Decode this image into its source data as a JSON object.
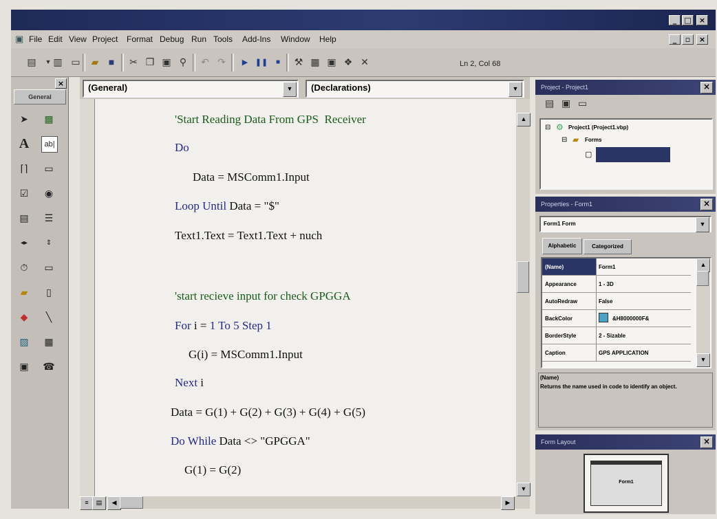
{
  "window": {
    "min_btn": "_",
    "max_btn": "□",
    "close_btn": "×",
    "doc_min_btn": "_",
    "doc_max_btn": "▫",
    "doc_close_btn": "×"
  },
  "menu": [
    "File",
    "Edit",
    "View",
    "Project",
    "Format",
    "Debug",
    "Run",
    "Tools",
    "Add-Ins",
    "Window",
    "Help"
  ],
  "toolbar": {
    "position": "Ln 2, Col 68"
  },
  "toolbox": {
    "title": "General",
    "close": "×"
  },
  "editor": {
    "object_combo": "(General)",
    "proc_combo": "(Declarations)",
    "lines": [
      {
        "text": "'Start Reading Data From GPS  Receiver"
      },
      {
        "kw": "Do"
      },
      {
        "text": "Data = MSComm1.Input"
      },
      {
        "kw": "Loop Until",
        "text": " Data = \"$\""
      },
      {
        "text": "Text1.Text = Text1.Text + nuch"
      },
      {
        "text": "'start recieve input for check GPGGA"
      },
      {
        "kw": "For",
        "text": " i = ",
        "kw2": "1 To 5 Step 1"
      },
      {
        "text": "G(i) = MSComm1.Input"
      },
      {
        "kw": "Next",
        "text": " i"
      },
      {
        "text": "Data = G(1) + G(2) + G(3) + G(4) + G(5)"
      },
      {
        "kw": "Do While",
        "text": " Data <> \"GPGGA\""
      },
      {
        "text": "G(1) = G(2)"
      }
    ]
  },
  "project": {
    "title": "Project - Project1",
    "root": "Project1 (Project1.vbp)",
    "folder": "Forms",
    "close": "×"
  },
  "properties": {
    "title": "Properties - Form1",
    "object_combo": "Form1 Form",
    "tab_alpha": "Alphabetic",
    "tab_cat": "Categorized",
    "rows": [
      {
        "name": "(Name)",
        "value": "Form1"
      },
      {
        "name": "Appearance",
        "value": "1 - 3D"
      },
      {
        "name": "AutoRedraw",
        "value": "False"
      },
      {
        "name": "BackColor",
        "value": "&H8000000F&"
      },
      {
        "name": "BorderStyle",
        "value": "2 - Sizable"
      },
      {
        "name": "Caption",
        "value": "GPS APPLICATION"
      }
    ],
    "desc_title": "(Name)",
    "desc_text": "Returns the name used in code to identify an object.",
    "close": "×"
  },
  "layout": {
    "title": "Form Layout",
    "form_label": "Form1",
    "close": "×"
  },
  "colors": {
    "titlebar": "#1f2a58",
    "comment": "#1a5c1a",
    "keyword": "#232a8e",
    "selection": "#2a3566"
  }
}
